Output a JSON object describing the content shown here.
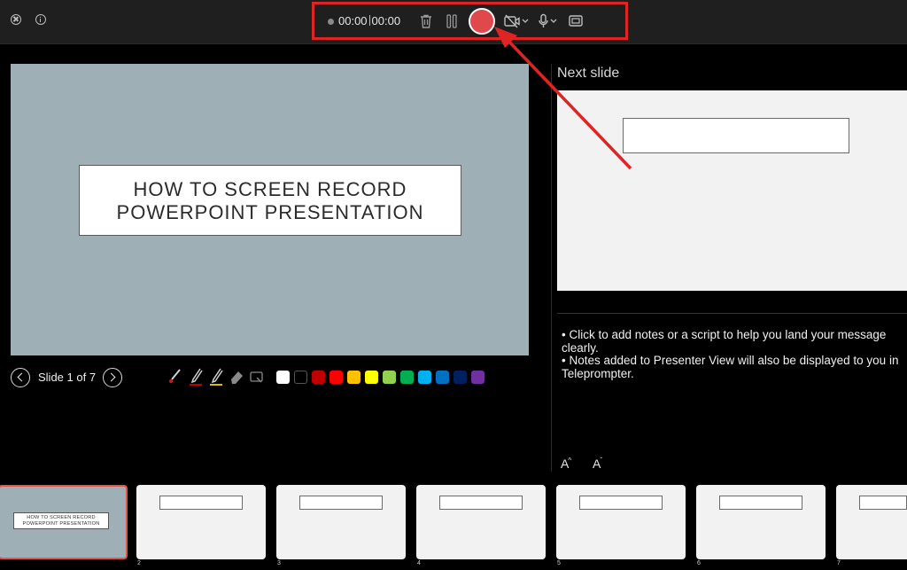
{
  "toolbar": {
    "timer_current": "00:00",
    "timer_total": "00:00",
    "highlight_color": "#e02424",
    "record_color": "#e0494b",
    "icons": [
      "close-icon",
      "info-icon",
      "trash-icon",
      "pause-icon",
      "record-icon",
      "camera-off-icon",
      "microphone-icon",
      "presenter-layout-icon"
    ]
  },
  "current_slide": {
    "title_line1": "HOW TO SCREEN RECORD",
    "title_line2": "POWERPOINT PRESENTATION",
    "background": "#9eb0b5"
  },
  "slide_nav": {
    "counter": "Slide 1 of 7"
  },
  "ink_colors": [
    "#ffffff",
    "#000000",
    "#c00000",
    "#ff0000",
    "#ffc000",
    "#ffff00",
    "#92d050",
    "#00b050",
    "#00b0f0",
    "#0070c0",
    "#002060",
    "#7030a0"
  ],
  "next_slide": {
    "label": "Next slide"
  },
  "notes": {
    "line1": "• Click to add notes or a script to help you land your message clearly.",
    "line2": "• Notes added to Presenter View will also be displayed to you in Teleprompter."
  },
  "font_controls": {
    "increase": "A",
    "decrease": "A"
  },
  "thumbnails": {
    "first_title_line1": "HOW TO SCREEN RECORD",
    "first_title_line2": "POWERPOINT PRESENTATION",
    "numbers": [
      "2",
      "3",
      "4",
      "5",
      "6",
      "7"
    ]
  }
}
